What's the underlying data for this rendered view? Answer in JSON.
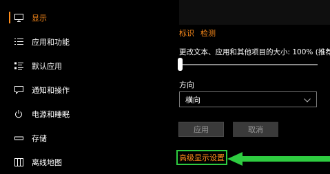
{
  "sidebar": {
    "items": [
      {
        "label": "显示",
        "icon": "monitor-icon",
        "active": true
      },
      {
        "label": "应用和功能",
        "icon": "list-icon"
      },
      {
        "label": "默认应用",
        "icon": "default-apps-icon"
      },
      {
        "label": "通知和操作",
        "icon": "notification-icon"
      },
      {
        "label": "电源和睡眠",
        "icon": "power-icon"
      },
      {
        "label": "存储",
        "icon": "storage-icon"
      },
      {
        "label": "离线地图",
        "icon": "map-icon"
      }
    ]
  },
  "main": {
    "links": {
      "identify": "标识",
      "detect": "检测"
    },
    "scale_label": "更改文本、应用和其他项目的大小: 100% (推荐",
    "scale_value_percent": 0,
    "orientation_label": "方向",
    "orientation_value": "横向",
    "apply_button": "应用",
    "cancel_button": "取消",
    "advanced_link": "高级显示设置"
  },
  "colors": {
    "accent": "#ff8c1a",
    "highlight": "#2ecc40",
    "background": "#000000"
  }
}
